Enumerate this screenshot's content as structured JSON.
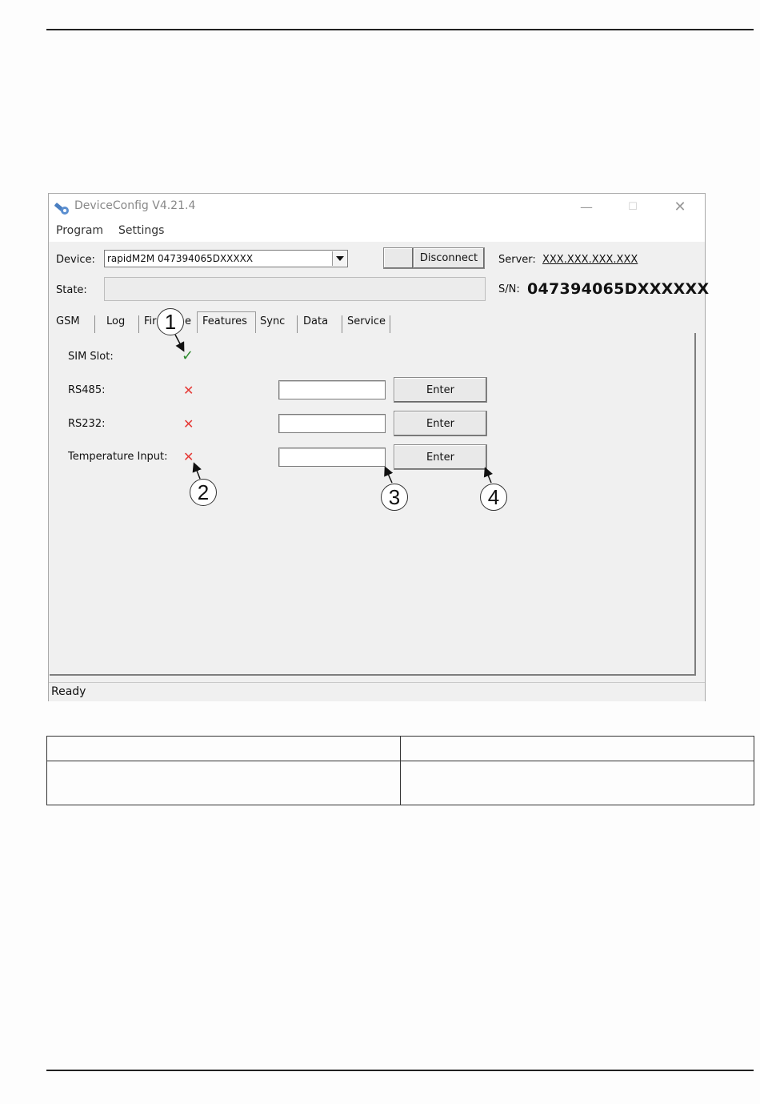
{
  "window": {
    "title": "DeviceConfig V4.21.4",
    "controls": {
      "minimize": "—",
      "maximize": "☐",
      "close": "✕"
    }
  },
  "menu": [
    "Program",
    "Settings"
  ],
  "device": {
    "label": "Device:",
    "value": "rapidM2M 047394065DXXXXX",
    "disconnect_label": "Disconnect",
    "server_label": "Server:",
    "server_value": "XXX.XXX.XXX.XXX",
    "state_label": "State:",
    "sn_label": "S/N:",
    "sn_value": "047394065DXXXXXX"
  },
  "tabs": [
    "GSM",
    "Log",
    "Fir",
    "e",
    "Features",
    "Sync",
    "Data",
    "Service"
  ],
  "active_tab": "Features",
  "features": [
    {
      "label": "SIM Slot:",
      "status": "enabled",
      "icon": "check-icon"
    },
    {
      "label": "RS485:",
      "status": "disabled",
      "icon": "cross-icon",
      "input": "",
      "button": "Enter"
    },
    {
      "label": "RS232:",
      "status": "disabled",
      "icon": "cross-icon",
      "input": "",
      "button": "Enter"
    },
    {
      "label": "Temperature Input:",
      "status": "disabled",
      "icon": "cross-icon",
      "input": "",
      "button": "Enter"
    }
  ],
  "status_bar": "Ready",
  "callouts": [
    "1",
    "2",
    "3",
    "4"
  ],
  "colors": {
    "check": "#2e8b2e",
    "cross": "#e53935"
  }
}
